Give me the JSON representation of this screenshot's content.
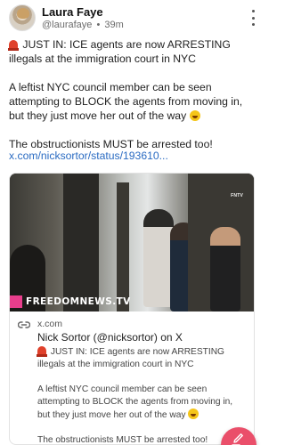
{
  "post": {
    "author_name": "Laura Faye",
    "handle": "@laurafaye",
    "separator": "•",
    "time": "39m",
    "paragraphs": [
      "JUST IN: ICE agents are now ARRESTING illegals at the immigration court in NYC",
      "A leftist NYC council member can be seen attempting to BLOCK the agents from moving in, but they just move her out of the way",
      "The obstructionists MUST be arrested too!"
    ],
    "link_text": "x.com/nicksortor/status/193610..."
  },
  "link_card": {
    "image_watermark": "FNTV",
    "image_brand": "FREEDOMNEWS.TV",
    "domain": "x.com",
    "title": "Nick Sortor (@nicksortor) on X",
    "description": [
      "JUST IN: ICE agents are now ARRESTING illegals at the immigration court in NYC",
      "A leftist NYC council member can be seen attempting to BLOCK the agents from moving in, but they just move her out of the way",
      "The obstructionists MUST be arrested too!"
    ]
  },
  "icons": {
    "more": "kebab-menu-icon",
    "link": "link-icon",
    "compose": "pencil-icon",
    "siren": "rotating-light-emoji",
    "laugh": "rolling-laughing-emoji"
  },
  "colors": {
    "link": "#2a6bc2",
    "fab": "#ea4f6a",
    "brand": "#e83e8c"
  }
}
